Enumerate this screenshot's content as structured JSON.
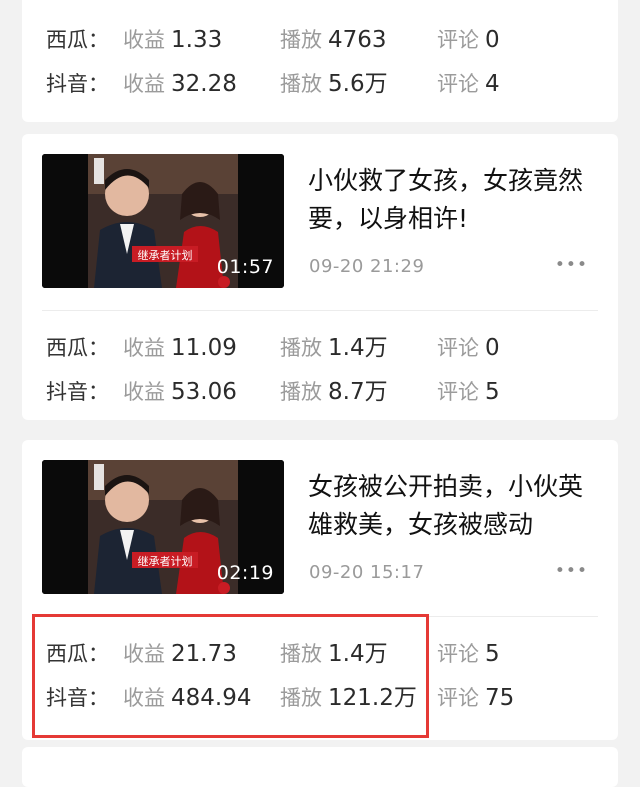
{
  "cards": [
    {
      "stats": [
        {
          "platform": "西瓜：",
          "income_label": "收益",
          "income": "1.33",
          "plays_label": "播放",
          "plays": "4763",
          "comments_label": "评论",
          "comments": "0"
        },
        {
          "platform": "抖音：",
          "income_label": "收益",
          "income": "32.28",
          "plays_label": "播放",
          "plays": "5.6万",
          "comments_label": "评论",
          "comments": "4"
        }
      ]
    },
    {
      "video": {
        "title": "小伙救了女孩，女孩竟然要，以身相许!",
        "time": "09-20 21:29",
        "duration": "01:57",
        "more": "•••",
        "badge": "继承者计划"
      },
      "stats": [
        {
          "platform": "西瓜：",
          "income_label": "收益",
          "income": "11.09",
          "plays_label": "播放",
          "plays": "1.4万",
          "comments_label": "评论",
          "comments": "0"
        },
        {
          "platform": "抖音：",
          "income_label": "收益",
          "income": "53.06",
          "plays_label": "播放",
          "plays": "8.7万",
          "comments_label": "评论",
          "comments": "5"
        }
      ]
    },
    {
      "video": {
        "title": "女孩被公开拍卖，小伙英雄救美，女孩被感动",
        "time": "09-20 15:17",
        "duration": "02:19",
        "more": "•••",
        "badge": "继承者计划"
      },
      "stats": [
        {
          "platform": "西瓜：",
          "income_label": "收益",
          "income": "21.73",
          "plays_label": "播放",
          "plays": "1.4万",
          "comments_label": "评论",
          "comments": "5"
        },
        {
          "platform": "抖音：",
          "income_label": "收益",
          "income": "484.94",
          "plays_label": "播放",
          "plays": "121.2万",
          "comments_label": "评论",
          "comments": "75"
        }
      ]
    }
  ],
  "colors": {
    "background": "#f2f2f2",
    "card": "#ffffff",
    "highlight": "#e53935"
  }
}
